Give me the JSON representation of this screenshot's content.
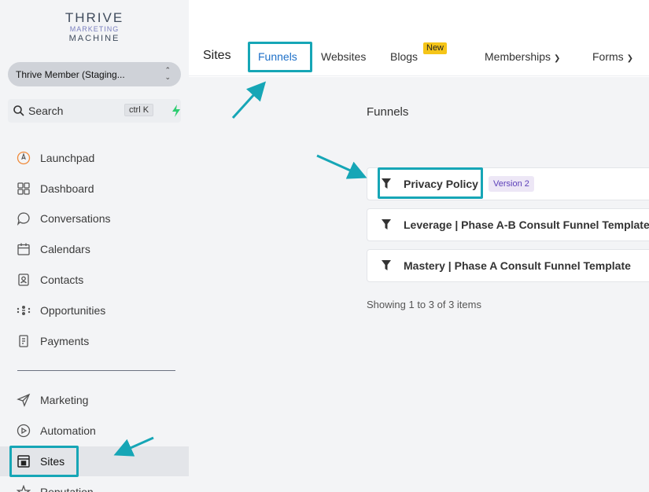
{
  "colors": {
    "highlight": "#16a6b6",
    "active_tab": "#1e70c8",
    "new_badge": "#f5c518",
    "version_badge_bg": "#ede7f6",
    "version_badge_text": "#5b3fb8",
    "quick_action": "#2ecc71"
  },
  "sidebar": {
    "logo": {
      "line1": "THRIVE",
      "line2": "MARKETING",
      "line3": "MACHINE"
    },
    "account": {
      "label": "Thrive Member (Staging..."
    },
    "search": {
      "label": "Search",
      "shortcut": "ctrl K"
    },
    "items": [
      {
        "label": "Launchpad",
        "icon": "launchpad-icon"
      },
      {
        "label": "Dashboard",
        "icon": "dashboard-icon"
      },
      {
        "label": "Conversations",
        "icon": "chat-icon"
      },
      {
        "label": "Calendars",
        "icon": "calendar-icon"
      },
      {
        "label": "Contacts",
        "icon": "contacts-icon"
      },
      {
        "label": "Opportunities",
        "icon": "opportunities-icon"
      },
      {
        "label": "Payments",
        "icon": "payments-icon"
      }
    ],
    "items2": [
      {
        "label": "Marketing",
        "icon": "send-icon"
      },
      {
        "label": "Automation",
        "icon": "automation-icon"
      },
      {
        "label": "Sites",
        "icon": "sites-icon",
        "active": true
      },
      {
        "label": "Reputation",
        "icon": "star-icon"
      }
    ]
  },
  "topnav": {
    "title": "Sites",
    "tabs": [
      {
        "label": "Funnels",
        "active": true
      },
      {
        "label": "Websites"
      },
      {
        "label": "Blogs",
        "badge": "New"
      },
      {
        "label": "Memberships",
        "dropdown": true
      },
      {
        "label": "Forms",
        "dropdown": true
      }
    ]
  },
  "main": {
    "title": "Funnels",
    "funnels": [
      {
        "name": "Privacy Policy",
        "badge": "Version 2"
      },
      {
        "name": "Leverage | Phase A-B Consult Funnel Template"
      },
      {
        "name": "Mastery | Phase A Consult Funnel Template"
      }
    ],
    "pagination": "Showing 1 to 3 of 3 items"
  }
}
